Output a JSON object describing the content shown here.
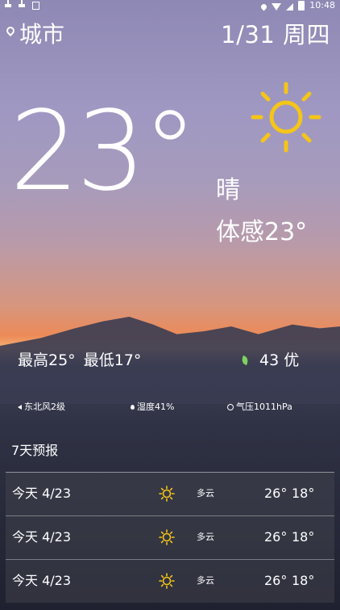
{
  "status_bar": {
    "time": "10:48"
  },
  "location": {
    "city": "城市"
  },
  "date": "1/31 周四",
  "current": {
    "temperature": "23°",
    "condition": "晴",
    "feels_like": "体感23°",
    "high": "最高25°",
    "low": "最低17°",
    "aqi": "43 优"
  },
  "details": {
    "wind": "东北风2级",
    "humidity": "湿度41%",
    "pressure": "气压1011hPa"
  },
  "forecast": {
    "title": "7天预报",
    "days": [
      {
        "day": "今天 4/23",
        "icon": "sun-icon",
        "desc": "多云",
        "high": "26°",
        "low": "18°"
      },
      {
        "day": "今天 4/23",
        "icon": "sun-icon",
        "desc": "多云",
        "high": "26°",
        "low": "18°"
      },
      {
        "day": "今天 4/23",
        "icon": "sun-icon",
        "desc": "多云",
        "high": "26°",
        "low": "18°"
      }
    ]
  },
  "colors": {
    "sun": "#f5c518",
    "leaf": "#7ed35f"
  }
}
